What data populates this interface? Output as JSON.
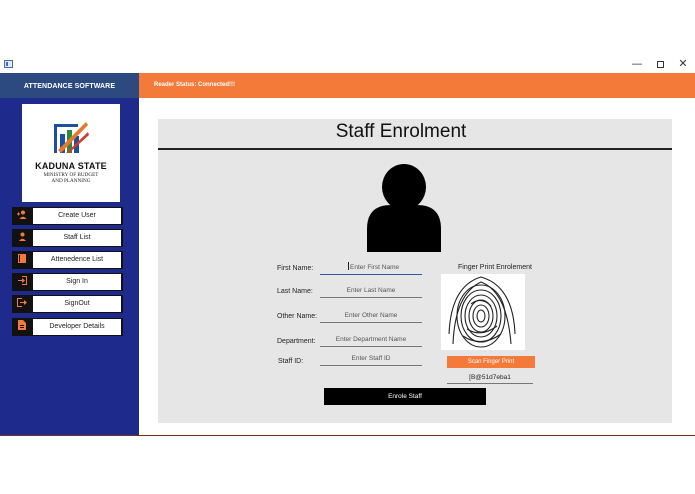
{
  "window": {
    "minimize_glyph": "—",
    "close_glyph": "✕"
  },
  "sidebar": {
    "header": "ATTENDANCE SOFTWARE",
    "logo": {
      "title": "KADUNA STATE",
      "subtitle_line1": "MINISTRY OF BUDGET",
      "subtitle_line2": "AND PLANNING"
    },
    "items": [
      {
        "label": "Create User",
        "icon": "add-user-icon"
      },
      {
        "label": "Staff List",
        "icon": "user-icon"
      },
      {
        "label": "Attenedence List",
        "icon": "book-icon"
      },
      {
        "label": "Sign In",
        "icon": "sign-in-icon"
      },
      {
        "label": "SignOut",
        "icon": "sign-out-icon"
      },
      {
        "label": "Developer Details",
        "icon": "document-icon"
      }
    ]
  },
  "status": {
    "text": "Reader Status: Connected!!!"
  },
  "form": {
    "title": "Staff Enrolment",
    "first_name_label": "First Name:",
    "first_name_placeholder": "Enter First Name",
    "last_name_label": "Last Name:",
    "last_name_placeholder": "Enter Last Name",
    "other_name_label": "Other Name:",
    "other_name_placeholder": "Enter Other Name",
    "department_label": "Department:",
    "department_placeholder": "Enter  Department Name",
    "staff_id_label": "Staff ID:",
    "staff_id_placeholder": "Enter Staff ID",
    "fingerprint_title": "Finger Print Enrolement",
    "scan_button": "Scan Finger Print",
    "fingerprint_value": "[B@51d7eba1",
    "enrol_button": "Enrole Staff"
  },
  "colors": {
    "accent": "#f47a3a",
    "sidebar": "#1f2b8c",
    "sidebar_header": "#2c4a80",
    "panel": "#e6e6e6"
  }
}
